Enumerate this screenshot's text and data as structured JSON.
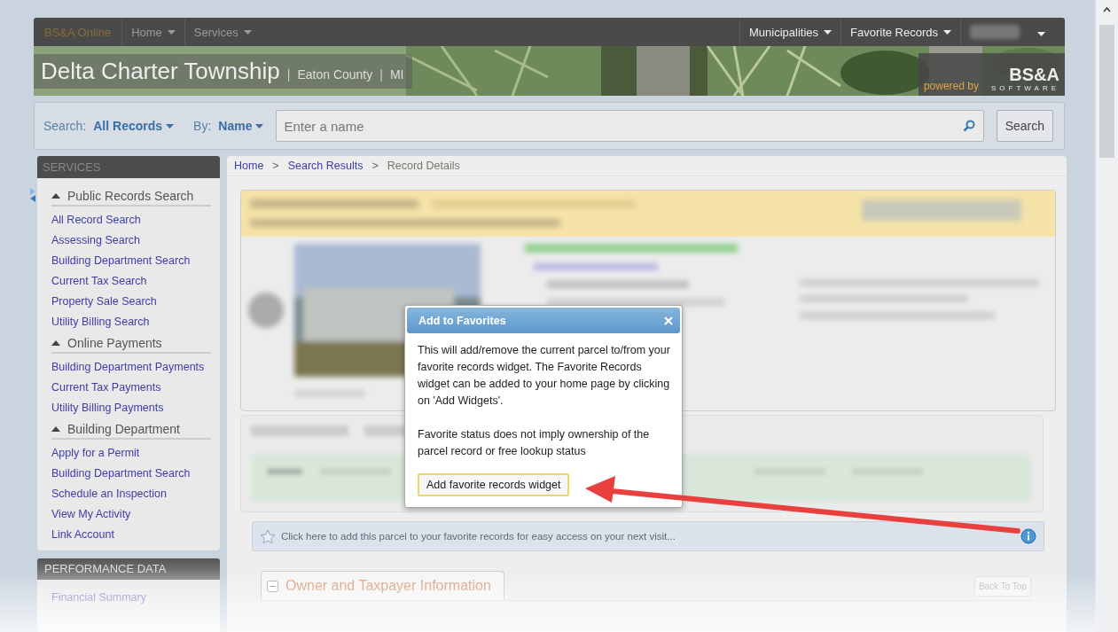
{
  "top_nav": {
    "brand": "BS&A Online",
    "menus": [
      {
        "label": "Home"
      },
      {
        "label": "Services"
      }
    ],
    "right_menus": [
      {
        "label": "Municipalities"
      },
      {
        "label": "Favorite Records"
      }
    ]
  },
  "banner": {
    "title": "Delta Charter Township",
    "separators": [
      "|",
      "|"
    ],
    "county": "Eaton County",
    "state": "MI",
    "powered_by": "powered by",
    "logo": "BS&A",
    "logo_sub": "SOFTWARE"
  },
  "search": {
    "search_label": "Search:",
    "search_value": "All Records",
    "by_label": "By:",
    "by_value": "Name",
    "placeholder": "Enter a name",
    "button": "Search"
  },
  "sidebar": {
    "title": "SERVICES",
    "sections": [
      {
        "title": "Public Records Search",
        "expanded": true,
        "items": [
          "All Record Search",
          "Assessing Search",
          "Building Department Search",
          "Current Tax Search",
          "Property Sale Search",
          "Utility Billing Search"
        ]
      },
      {
        "title": "Online Payments",
        "expanded": true,
        "items": [
          "Building Department Payments",
          "Current Tax Payments",
          "Utility Billing Payments"
        ]
      },
      {
        "title": "Building Department",
        "expanded": true,
        "items": [
          "Apply for a Permit",
          "Building Department Search",
          "Schedule an Inspection",
          "View My Activity",
          "Link Account"
        ]
      }
    ],
    "performance": {
      "title": "PERFORMANCE DATA",
      "items": [
        "Financial Summary"
      ]
    }
  },
  "breadcrumb": [
    {
      "label": "Home"
    },
    {
      "label": "Search Results"
    },
    {
      "label": "Record Details"
    }
  ],
  "breadcrumb_separators": [
    ">",
    ">"
  ],
  "favorite_bar": {
    "text": "Click here to add this parcel to your favorite records for easy access on your next visit..."
  },
  "section_tab": {
    "title": "Owner and Taxpayer Information",
    "back_to_top": "Back To Top"
  },
  "dialog": {
    "title": "Add to Favorites",
    "paragraphs": [
      "This will add/remove the current parcel to/from your favorite records widget. The Favorite Records widget can be added to your home page by clicking on 'Add Widgets'.",
      "Favorite status does not imply ownership of the parcel record or free lookup status"
    ],
    "button": "Add favorite records widget"
  }
}
